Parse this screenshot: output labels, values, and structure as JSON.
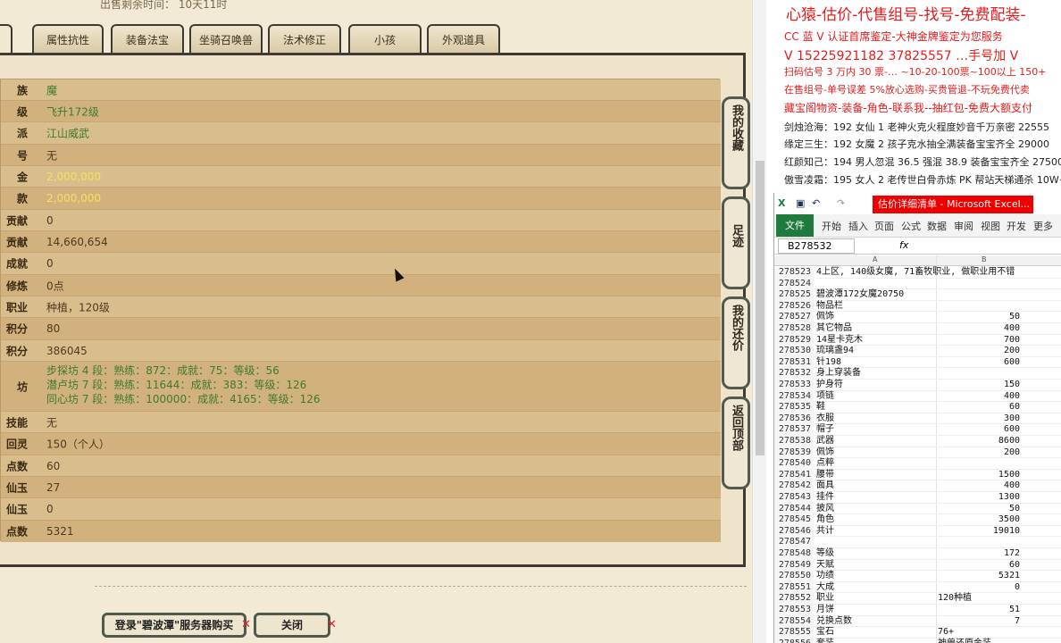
{
  "game": {
    "top_note": "出售剩余时间：  10天11时",
    "tabs": [
      {
        "label": "息"
      },
      {
        "label": "属性抗性"
      },
      {
        "label": "装备法宝"
      },
      {
        "label": "坐骑召唤兽"
      },
      {
        "label": "法术修正"
      },
      {
        "label": "小孩"
      },
      {
        "label": "外观道具"
      }
    ],
    "rows": [
      {
        "label": "族",
        "value": "魔",
        "style": "green"
      },
      {
        "label": "级",
        "value": "飞升172级",
        "style": "green"
      },
      {
        "label": "派",
        "value": "江山威武",
        "style": "green"
      },
      {
        "label": "号",
        "value": "无",
        "style": "normal"
      },
      {
        "label": "金",
        "value": "2,000,000",
        "style": "gold"
      },
      {
        "label": "款",
        "value": "2,000,000",
        "style": "gold"
      },
      {
        "label": "贡献",
        "value": "0",
        "style": "normal"
      },
      {
        "label": "贡献",
        "value": "14,660,654",
        "style": "normal"
      },
      {
        "label": "成就",
        "value": "0",
        "style": "normal"
      },
      {
        "label": "修炼",
        "value": "0点",
        "style": "normal"
      },
      {
        "label": "职业",
        "value": "种植，120级",
        "style": "normal"
      },
      {
        "label": "积分",
        "value": "80",
        "style": "normal"
      },
      {
        "label": "积分",
        "value": "386045",
        "style": "normal"
      },
      {
        "label": "坊",
        "lines": [
          "步探坊 4 段：熟练：872：成就：75：等级：56",
          "潜卢坊 7 段：熟练：11644：成就：383：等级：126",
          "同心坊 7 段：熟练：100000：成就：4165：等级：126"
        ]
      },
      {
        "label": "技能",
        "value": "无",
        "style": "normal"
      },
      {
        "label": "回灵",
        "value": "150（个人）",
        "style": "normal"
      },
      {
        "label": "点数",
        "value": "60",
        "style": "normal"
      },
      {
        "label": "仙玉",
        "value": "27",
        "style": "normal"
      },
      {
        "label": "仙玉",
        "value": "0",
        "style": "normal"
      },
      {
        "label": "点数",
        "value": "5321",
        "style": "normal"
      }
    ],
    "side_buttons": [
      "我的收藏",
      "足迹",
      "我的还价",
      "返回顶部"
    ],
    "bottom_buttons": {
      "buy": "登录\"碧波潭\"服务器购买",
      "close": "关闭"
    }
  },
  "ad": {
    "title": "心猿-估价-代售组号-找号-免费配装-",
    "lines": [
      {
        "text": "CC 蓝 V 认证首席鉴定-大神金牌鉴定为您服务",
        "color": "red"
      },
      {
        "text": "V 15225921182    37825557   …手号加 V",
        "color": "red"
      },
      {
        "text": "扫码估号 3 万内 30 票-… ~10-20-100票~100以上 150+",
        "color": "red"
      },
      {
        "text": "在售组号-单号误差 5%放心选购-买贵管退-不玩免费代卖",
        "color": "red"
      },
      {
        "text": "藏宝阁物资-装备-角色-联系我--抽红包-免费大额支付",
        "color": "red"
      },
      {
        "text": "剑烛沧海：192 女仙 1 老神火克火程度妙音千万亲密 22555",
        "color": "black"
      },
      {
        "text": "缘定三生：192 女魔 2 孩子克水抽全满装备宝宝齐全 29000",
        "color": "black"
      },
      {
        "text": "红颜知己：194 男人忽混 36.5 强混 38.9 装备宝宝齐全 27500",
        "color": "black"
      },
      {
        "text": "傲雪凌霜：195 女人 2 老传世白骨赤炼 PK 帮站天梯通杀 10W+",
        "color": "black"
      }
    ]
  },
  "excel": {
    "window_title": "估价详细清单 - Microsoft Excel...",
    "ribbon_tabs": [
      "文件",
      "开始",
      "插入",
      "页面",
      "公式",
      "数据",
      "审阅",
      "视图",
      "开发",
      "更多"
    ],
    "name_box": "B278532",
    "fx": "fx",
    "col_a": "A",
    "col_b": "B",
    "rows": [
      {
        "n": "278523",
        "a": "4上区, 140级女魔, 71畜牧职业, 做职业用不错",
        "b": ""
      },
      {
        "n": "278524",
        "a": "",
        "b": ""
      },
      {
        "n": "278525",
        "a": "碧波潭172女魔20750",
        "b": ""
      },
      {
        "n": "278526",
        "a": "物品栏",
        "b": ""
      },
      {
        "n": "278527",
        "a": "佩饰",
        "b": "50"
      },
      {
        "n": "278528",
        "a": "其它物品",
        "b": "400"
      },
      {
        "n": "278529",
        "a": "14星卡克木",
        "b": "700"
      },
      {
        "n": "278530",
        "a": "琉璃盏94",
        "b": "200"
      },
      {
        "n": "278531",
        "a": "针198",
        "b": "600"
      },
      {
        "n": "278532",
        "a": "身上穿装备",
        "b": ""
      },
      {
        "n": "278533",
        "a": "护身符",
        "b": "150"
      },
      {
        "n": "278534",
        "a": "项链",
        "b": "400"
      },
      {
        "n": "278535",
        "a": "鞋",
        "b": "60"
      },
      {
        "n": "278536",
        "a": "衣服",
        "b": "300"
      },
      {
        "n": "278537",
        "a": "帽子",
        "b": "600"
      },
      {
        "n": "278538",
        "a": "武器",
        "b": "8600"
      },
      {
        "n": "278539",
        "a": "佩饰",
        "b": "200"
      },
      {
        "n": "278540",
        "a": "点粹",
        "b": ""
      },
      {
        "n": "278541",
        "a": "腰带",
        "b": "1500"
      },
      {
        "n": "278542",
        "a": "面具",
        "b": "400"
      },
      {
        "n": "278543",
        "a": "挂件",
        "b": "1300"
      },
      {
        "n": "278544",
        "a": "披风",
        "b": "50"
      },
      {
        "n": "278545",
        "a": "角色",
        "b": "3500"
      },
      {
        "n": "278546",
        "a": "共计",
        "b": "19010"
      },
      {
        "n": "278547",
        "a": "",
        "b": ""
      },
      {
        "n": "278548",
        "a": "等级",
        "b": "172"
      },
      {
        "n": "278549",
        "a": "天赋",
        "b": "60"
      },
      {
        "n": "278550",
        "a": "功绩",
        "b": "5321"
      },
      {
        "n": "278551",
        "a": "大成",
        "b": "0"
      },
      {
        "n": "278552",
        "a": "职业",
        "bl": "120种植"
      },
      {
        "n": "278553",
        "a": "月饼",
        "b": "51"
      },
      {
        "n": "278554",
        "a": "兑换点数",
        "b": "7"
      },
      {
        "n": "278555",
        "a": "宝石",
        "bl": "76+"
      },
      {
        "n": "278556",
        "a": "套装",
        "bl": "神兽还原金装"
      }
    ]
  }
}
